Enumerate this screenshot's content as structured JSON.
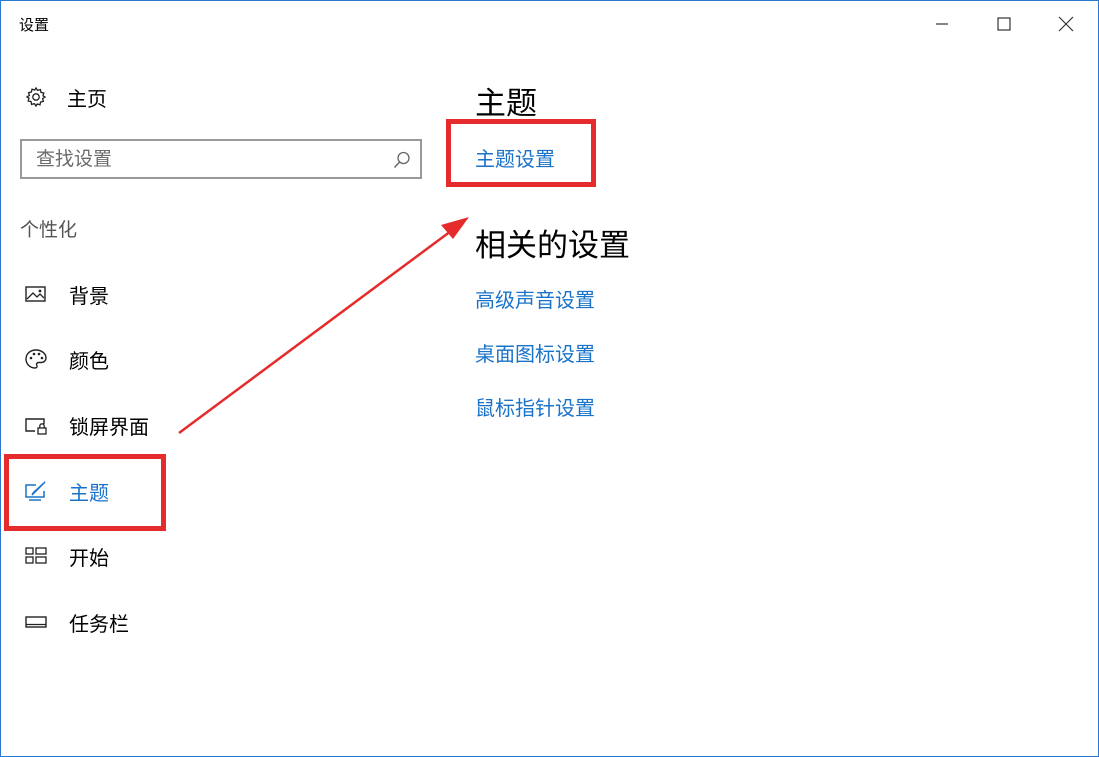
{
  "window": {
    "title": "设置"
  },
  "sidebar": {
    "home_label": "主页",
    "search": {
      "placeholder": "查找设置"
    },
    "section_label": "个性化",
    "items": [
      {
        "label": "背景",
        "icon": "picture-icon"
      },
      {
        "label": "颜色",
        "icon": "palette-icon"
      },
      {
        "label": "锁屏界面",
        "icon": "lock-screen-icon"
      },
      {
        "label": "主题",
        "icon": "theme-brush-icon",
        "selected": true
      },
      {
        "label": "开始",
        "icon": "start-tiles-icon"
      },
      {
        "label": "任务栏",
        "icon": "taskbar-icon"
      }
    ]
  },
  "main": {
    "theme_heading": "主题",
    "theme_settings_link": "主题设置",
    "related_heading": "相关的设置",
    "related_links": [
      "高级声音设置",
      "桌面图标设置",
      "鼠标指针设置"
    ]
  },
  "colors": {
    "accent": "#1a73c9",
    "annotation": "#e52b2b",
    "window_border": "#2b78d0"
  }
}
